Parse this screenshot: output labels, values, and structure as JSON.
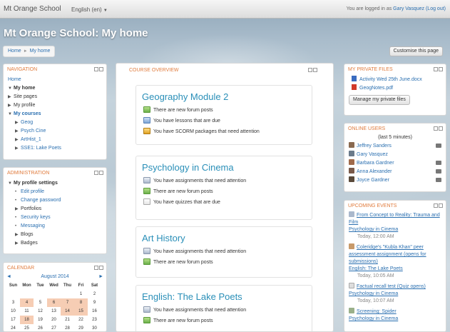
{
  "navbar": {
    "brand": "Mt Orange School",
    "language": "English (en)",
    "login_prefix": "You are logged in as",
    "user": "Gary Vasquez",
    "logout": "(Log out)"
  },
  "page": {
    "heading": "Mt Orange School: My home",
    "breadcrumb": [
      "Home",
      "My home"
    ],
    "customise_button": "Customise this page"
  },
  "navigation": {
    "title": "NAVIGATION",
    "home": "Home",
    "items": [
      "My home",
      "Site pages",
      "My profile",
      "My courses"
    ],
    "courses": [
      "Geog",
      "Psych Cine",
      "ArtHist_1",
      "SSE1: Lake Poets"
    ]
  },
  "administration": {
    "title": "ADMINISTRATION",
    "section": "My profile settings",
    "items": [
      "Edit profile",
      "Change password",
      "Portfolios",
      "Security keys",
      "Messaging",
      "Blogs",
      "Badges"
    ]
  },
  "calendar": {
    "title": "CALENDAR",
    "month": "August 2014",
    "prev": "◄",
    "next": "►",
    "days": [
      "Sun",
      "Mon",
      "Tue",
      "Wed",
      "Thu",
      "Fri",
      "Sat"
    ],
    "weeks": [
      [
        "",
        "",
        "",
        "",
        "",
        "1",
        "2"
      ],
      [
        "3",
        "4",
        "5",
        "6",
        "7",
        "8",
        "9"
      ],
      [
        "10",
        "11",
        "12",
        "13",
        "14",
        "15",
        "16"
      ],
      [
        "17",
        "18",
        "19",
        "20",
        "21",
        "22",
        "23"
      ],
      [
        "24",
        "25",
        "26",
        "27",
        "28",
        "29",
        "30"
      ]
    ],
    "highlighted": [
      "4",
      "6",
      "7",
      "8",
      "14",
      "15",
      "18"
    ]
  },
  "course_overview": {
    "title": "COURSE OVERVIEW",
    "courses": [
      {
        "name": "Geography Module 2",
        "notices": [
          {
            "icon": "forum-icon",
            "text": "There are new forum posts"
          },
          {
            "icon": "lesson-icon",
            "text": "You have lessons that are due"
          },
          {
            "icon": "scorm-icon",
            "text": "You have SCORM packages that need attention"
          }
        ]
      },
      {
        "name": "Psychology in Cinema",
        "notices": [
          {
            "icon": "assignment-icon",
            "text": "You have assignments that need attention"
          },
          {
            "icon": "forum-icon",
            "text": "There are new forum posts"
          },
          {
            "icon": "quiz-icon",
            "text": "You have quizzes that are due"
          }
        ]
      },
      {
        "name": "Art History",
        "notices": [
          {
            "icon": "assignment-icon",
            "text": "You have assignments that need attention"
          },
          {
            "icon": "forum-icon",
            "text": "There are new forum posts"
          }
        ]
      },
      {
        "name": "English: The Lake Poets",
        "notices": [
          {
            "icon": "assignment-icon",
            "text": "You have assignments that need attention"
          },
          {
            "icon": "forum-icon",
            "text": "There are new forum posts"
          }
        ]
      }
    ]
  },
  "private_files": {
    "title": "MY PRIVATE FILES",
    "files": [
      {
        "icon": "doc-icon",
        "name": "Activity Wed 25th June.docx"
      },
      {
        "icon": "pdf-icon",
        "name": "GeogNotes.pdf"
      }
    ],
    "manage_button": "Manage my private files"
  },
  "online_users": {
    "title": "ONLINE USERS",
    "subtitle": "(last 5 minutes)",
    "users": [
      "Jeffrey Sanders",
      "Gary Vasquez",
      "Barbara Gardner",
      "Anna Alexander",
      "Joyce Gardner"
    ]
  },
  "upcoming_events": {
    "title": "UPCOMING EVENTS",
    "events": [
      {
        "title": "From Concept to Reality: Trauma and Film",
        "course": "Psychology in Cinema",
        "time": "Today, 12:00 AM"
      },
      {
        "title": "Coleridge's \"Kubla Khan\" peer assessment assignment (opens for submissions)",
        "course": "English: The Lake Poets",
        "time": "Today, 10:05 AM"
      },
      {
        "title": "Factual recall test (Quiz opens)",
        "course": "Psychology in Cinema",
        "time": "Today, 10:07 AM"
      },
      {
        "title": "Screening: Spider",
        "course": "Psychology in Cinema",
        "time": ""
      }
    ]
  }
}
